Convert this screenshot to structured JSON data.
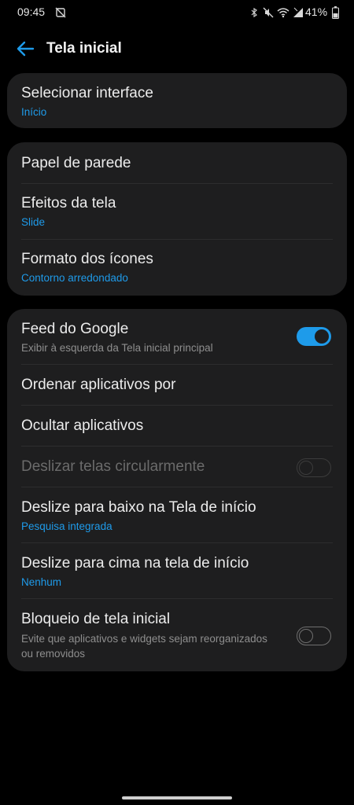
{
  "status_bar": {
    "time": "09:45",
    "battery": "41%",
    "icons": [
      "do-not-disturb-icon",
      "bluetooth-icon",
      "mute-icon",
      "wifi-icon",
      "signal-icon",
      "battery-icon"
    ]
  },
  "header": {
    "title": "Tela inicial",
    "back_icon": "back-arrow-icon"
  },
  "colors": {
    "accent": "#1e9bea",
    "card": "#1e1e1f",
    "background": "#000000"
  },
  "cards": [
    {
      "items": [
        {
          "title": "Selecionar interface",
          "subtitle": "Início"
        }
      ]
    },
    {
      "items": [
        {
          "title": "Papel de parede"
        },
        {
          "title": "Efeitos da tela",
          "subtitle": "Slide"
        },
        {
          "title": "Formato dos ícones",
          "subtitle": "Contorno arredondado"
        }
      ]
    },
    {
      "items": [
        {
          "title": "Feed do Google",
          "description": "Exibir à esquerda da Tela inicial principal",
          "toggle": "on"
        },
        {
          "title": "Ordenar aplicativos por"
        },
        {
          "title": "Ocultar aplicativos"
        },
        {
          "title": "Deslizar telas circularmente",
          "toggle": "off",
          "disabled": true
        },
        {
          "title": "Deslize para baixo na Tela de início",
          "subtitle": "Pesquisa integrada"
        },
        {
          "title": "Deslize para cima na tela de início",
          "subtitle": "Nenhum"
        },
        {
          "title": "Bloqueio de tela inicial",
          "description": "Evite que aplicativos e widgets sejam reorganizados ou removidos",
          "toggle": "off"
        }
      ]
    }
  ]
}
